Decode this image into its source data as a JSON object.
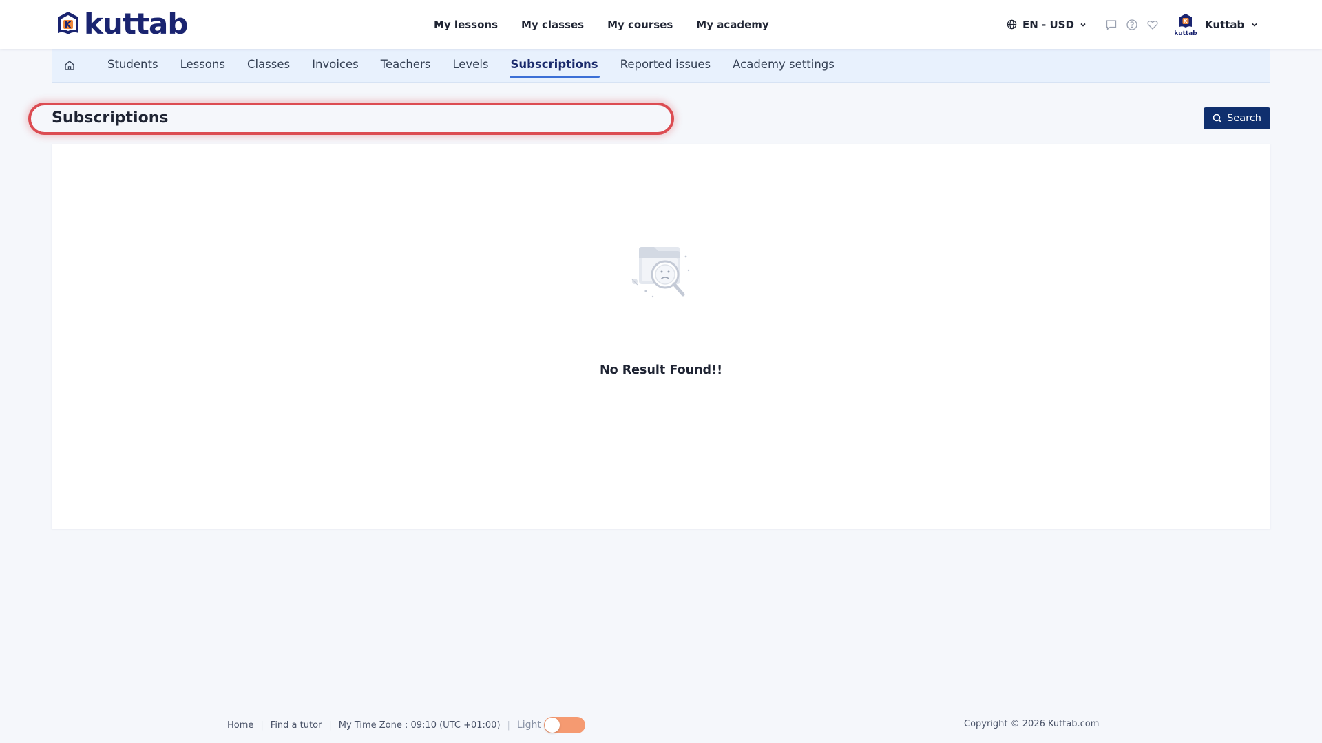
{
  "header": {
    "logo_text": "kuttab",
    "nav": [
      {
        "label": "My lessons"
      },
      {
        "label": "My classes"
      },
      {
        "label": "My courses"
      },
      {
        "label": "My academy"
      }
    ],
    "locale": "EN - USD",
    "user_name": "Kuttab",
    "avatar_text": "kuttab"
  },
  "subnav": {
    "items": [
      {
        "label": "Students"
      },
      {
        "label": "Lessons"
      },
      {
        "label": "Classes"
      },
      {
        "label": "Invoices"
      },
      {
        "label": "Teachers"
      },
      {
        "label": "Levels"
      },
      {
        "label": "Subscriptions",
        "active": true
      },
      {
        "label": "Reported issues"
      },
      {
        "label": "Academy settings"
      }
    ]
  },
  "page": {
    "title": "Subscriptions",
    "search_label": "Search"
  },
  "empty_state": {
    "message": "No Result Found!!"
  },
  "footer": {
    "home": "Home",
    "find_tutor": "Find a tutor",
    "timezone": "My Time Zone : 09:10 (UTC +01:00)",
    "theme_label": "Light",
    "copyright": "Copyright © 2026 Kuttab.com"
  },
  "colors": {
    "brand_navy": "#1a2470",
    "primary_button": "#0f2f6e",
    "subnav_bg": "#e8f1fd",
    "active_underline": "#3b6fd6",
    "highlight_ring": "#dc4c52",
    "toggle_orange": "#f59a71",
    "logo_accent": "#f08a3c"
  }
}
